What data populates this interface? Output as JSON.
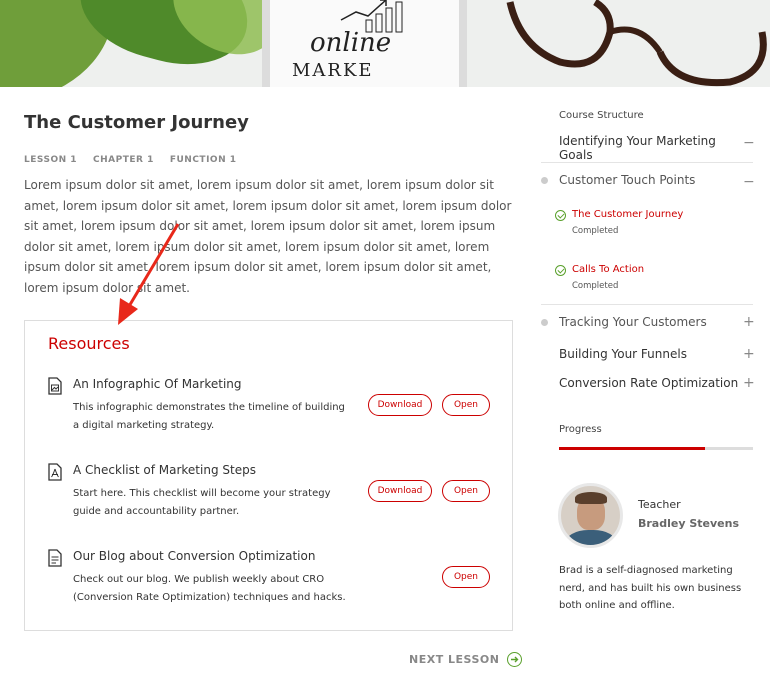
{
  "hero": {
    "image_text_line1": "online",
    "image_text_line2": "MARKE"
  },
  "lesson": {
    "title": "The Customer Journey",
    "meta": [
      "LESSON 1",
      "CHAPTER 1",
      "FUNCTION 1"
    ],
    "body": "Lorem ipsum dolor sit amet, lorem ipsum dolor sit amet, lorem ipsum dolor sit amet, lorem ipsum dolor sit amet, lorem ipsum dolor sit amet, lorem ipsum dolor sit amet, lorem ipsum dolor sit amet, lorem ipsum dolor sit amet, lorem ipsum dolor sit amet, lorem ipsum dolor sit amet, lorem ipsum dolor sit amet, lorem ipsum dolor sit amet, lorem ipsum dolor sit amet, lorem ipsum dolor sit amet, lorem ipsum dolor sit amet."
  },
  "resources": {
    "heading": "Resources",
    "items": [
      {
        "icon": "image-file-icon",
        "name": "An Infographic Of Marketing",
        "description": "This infographic demonstrates the timeline of building a digital marketing strategy.",
        "download_label": "Download",
        "open_label": "Open"
      },
      {
        "icon": "pdf-file-icon",
        "name": "A Checklist of Marketing Steps",
        "description": "Start here. This checklist will become your strategy guide and accountability partner.",
        "download_label": "Download",
        "open_label": "Open"
      },
      {
        "icon": "document-icon",
        "name": "Our Blog about Conversion Optimization",
        "description": "Check out our blog. We publish weekly about CRO (Conversion Rate Optimization) techniques and hacks.",
        "open_label": "Open"
      }
    ]
  },
  "next_lesson": {
    "label": "NEXT LESSON"
  },
  "sidebar": {
    "course_structure_label": "Course Structure",
    "sections": [
      {
        "title": "Identifying Your Marketing Goals",
        "toggle": "−"
      },
      {
        "title": "Customer Touch Points",
        "toggle": "−",
        "lessons": [
          {
            "name": "The Customer Journey",
            "status": "Completed"
          },
          {
            "name": "Calls To Action",
            "status": "Completed"
          }
        ]
      },
      {
        "title": "Tracking Your Customers",
        "toggle": "+"
      },
      {
        "title": "Building Your Funnels",
        "toggle": "+"
      },
      {
        "title": "Conversion Rate Optimization",
        "toggle": "+"
      }
    ],
    "progress_label": "Progress",
    "progress_value": 0.75,
    "teacher": {
      "role": "Teacher",
      "name": "Bradley Stevens",
      "bio": "Brad is a self-diagnosed marketing nerd, and has built his own business both online and offline."
    }
  },
  "colors": {
    "accent": "#cc0000",
    "success": "#5aa02c",
    "annotation_arrow": "#e8281a"
  }
}
